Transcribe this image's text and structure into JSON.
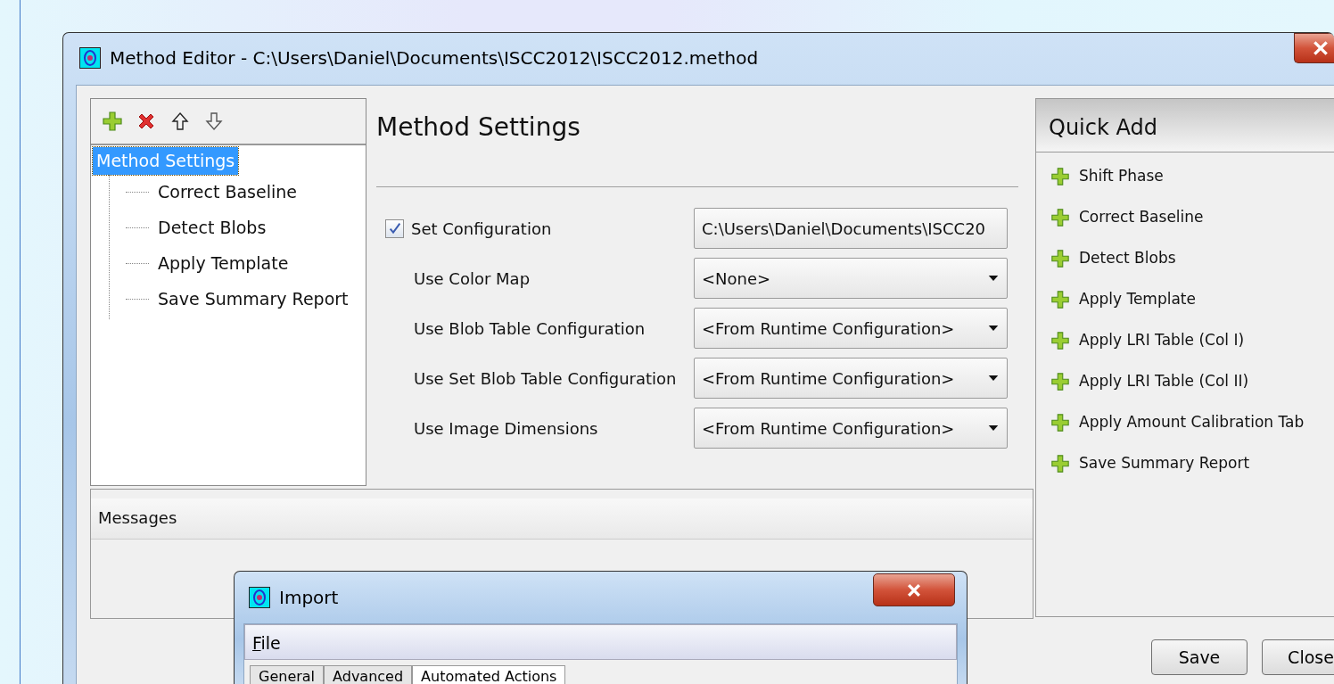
{
  "window": {
    "title": "Method Editor - C:\\Users\\Daniel\\Documents\\ISCC2012\\ISCC2012.method"
  },
  "tree": {
    "toolbar": [
      {
        "kind": "add"
      },
      {
        "kind": "remove"
      },
      {
        "kind": "up"
      },
      {
        "kind": "down"
      }
    ],
    "items": [
      {
        "label": "Method Settings",
        "selected": true,
        "children": [
          {
            "label": "Correct Baseline",
            "selected": false
          },
          {
            "label": "Detect Blobs",
            "selected": false
          },
          {
            "label": "Apply Template",
            "selected": false
          },
          {
            "label": "Save Summary Report",
            "selected": false
          }
        ]
      }
    ]
  },
  "settings": {
    "title": "Method Settings",
    "rows": [
      {
        "kind": "checkbox",
        "label": "Set Configuration",
        "checked": true,
        "dropdown": false,
        "value": "C:\\Users\\Daniel\\Documents\\ISCC20"
      },
      {
        "kind": "label",
        "label": "Use Color Map",
        "dropdown": true,
        "value": "<None>"
      },
      {
        "kind": "label",
        "label": "Use Blob Table Configuration",
        "dropdown": true,
        "value": "<From Runtime Configuration>"
      },
      {
        "kind": "label",
        "label": "Use Set Blob Table Configuration",
        "dropdown": true,
        "value": "<From Runtime Configuration>"
      },
      {
        "kind": "label",
        "label": "Use Image Dimensions",
        "dropdown": true,
        "value": "<From Runtime Configuration>"
      }
    ]
  },
  "quick_add": {
    "title": "Quick Add",
    "items": [
      "Shift Phase",
      "Correct Baseline",
      "Detect Blobs",
      "Apply Template",
      "Apply LRI Table (Col I)",
      "Apply LRI Table (Col II)",
      "Apply Amount Calibration Tab",
      "Save Summary Report"
    ]
  },
  "messages": {
    "title": "Messages"
  },
  "buttons": [
    "Save",
    "Close"
  ],
  "import_dialog": {
    "title": "Import",
    "menu": [
      {
        "label": "File",
        "mnemonic": true
      }
    ],
    "tabs": [
      {
        "label": "General",
        "selected": false
      },
      {
        "label": "Advanced",
        "selected": false
      },
      {
        "label": "Automated Actions",
        "selected": true
      }
    ]
  }
}
